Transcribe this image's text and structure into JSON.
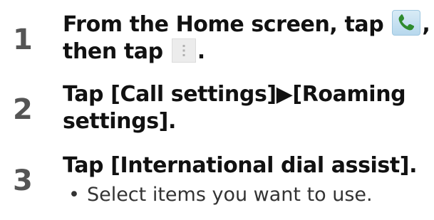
{
  "steps": [
    {
      "number": "1",
      "line1_before": "From the Home screen, tap ",
      "line1_after": ",",
      "line2_before": "then tap ",
      "line2_after": ".",
      "icon1": "phone-icon",
      "icon2": "menu-icon"
    },
    {
      "number": "2",
      "line1": "Tap [Call settings]▶[Roaming",
      "line2": "settings]."
    },
    {
      "number": "3",
      "line1": "Tap [International dial assist].",
      "bullet": "•",
      "bullet_text": "Select items you want to use."
    }
  ],
  "colors": {
    "number": "#555555",
    "text": "#111111",
    "phone_icon_bg": "#cfe6f5",
    "phone_icon_fg": "#2e8b2e",
    "menu_icon_bg": "#ececec"
  }
}
